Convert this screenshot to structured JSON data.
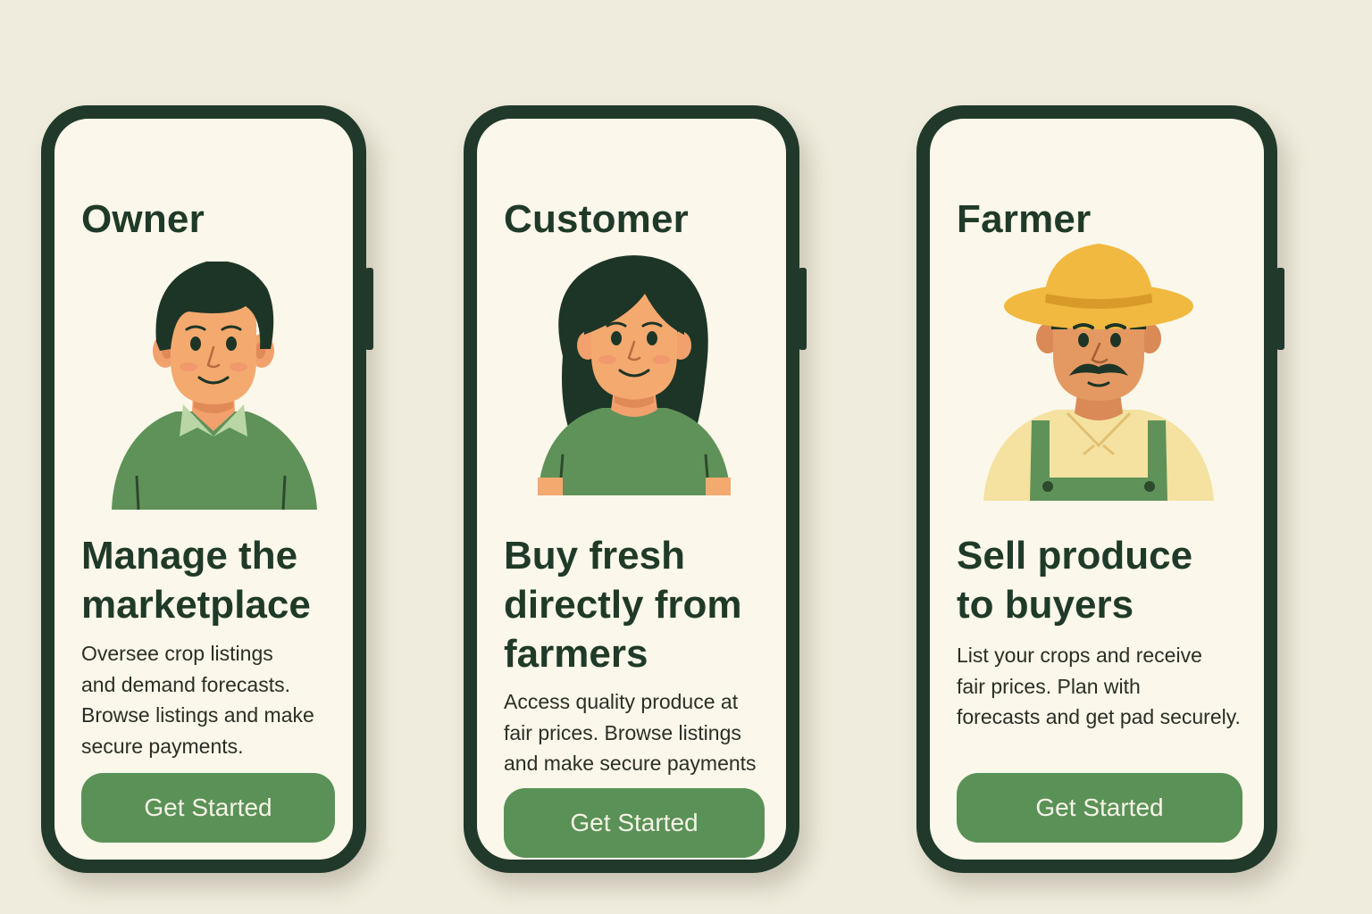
{
  "cards": [
    {
      "role": "Owner",
      "headline": "Manage the\nmarketplace",
      "description": "Oversee crop listings\nand demand forecasts.\nBrowse listings and make\nsecure payments.",
      "cta_label": "Get Started",
      "avatar": "owner-avatar"
    },
    {
      "role": "Customer",
      "headline": "Buy fresh\ndirectly from\nfarmers",
      "description": "Access quality produce at\nfair prices. Browse listings\nand make secure payments",
      "cta_label": "Get Started",
      "avatar": "customer-avatar"
    },
    {
      "role": "Farmer",
      "headline": "Sell produce\nto buyers",
      "description": "List your crops and receive\nfair prices. Plan with\nforecasts and get pad securely.",
      "cta_label": "Get Started",
      "avatar": "farmer-avatar"
    }
  ],
  "colors": {
    "background": "#f0ecdd",
    "phone_frame": "#20392a",
    "screen": "#fbf7ea",
    "accent_green": "#5a9157",
    "heading_text": "#1f3a28"
  }
}
